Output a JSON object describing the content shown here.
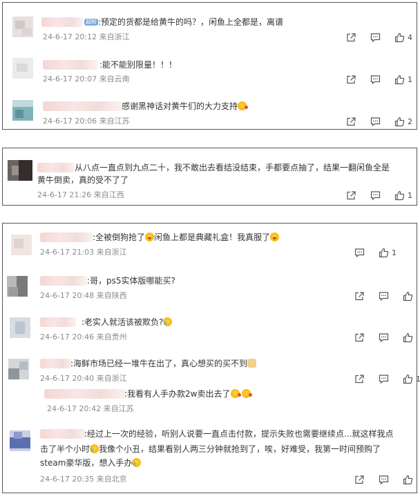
{
  "panels": [
    {
      "comments": [
        {
          "text": "预定的货都是给黄牛的吗？，闲鱼上全都是，离谱",
          "badge": "超粉",
          "date": "24-6-17 20:12",
          "location": "来自浙江",
          "likes": "4"
        },
        {
          "text": "能不能别限量！！！",
          "date": "24-6-17 20:07",
          "location": "来自云南",
          "likes": "1"
        },
        {
          "text": "感谢黑神话对黄牛们的大力支持",
          "date": "24-6-17 20:06",
          "location": "来自江苏",
          "likes": "2"
        }
      ]
    },
    {
      "comments": [
        {
          "text_line1": "从八点一直点到九点二十，我不敢出去看结没结束，手都要点抽了，结果一翻闲鱼全是",
          "text_line2": "黄牛倒卖，真的受不了了",
          "date": "24-6-17 21:26",
          "location": "来自江西",
          "likes": "1"
        }
      ]
    },
    {
      "comments": [
        {
          "text_a": "全被倒狗抢了",
          "text_b": "闲鱼上都是典藏礼盒！我真服了",
          "date": "24-6-17 21:03",
          "location": "来自浙江",
          "likes": "1"
        },
        {
          "text": "哥，ps5实体版哪能买?",
          "date": "24-6-17 20:48",
          "location": "来自陕西"
        },
        {
          "text": "老实人就活该被欺负?",
          "date": "24-6-17 20:46",
          "location": "来自贵州"
        },
        {
          "text": "海鲜市场已经一堆牛在出了，真心想买的买不到",
          "date": "24-6-17 20:40",
          "location": "来自浙江",
          "likes": "1"
        },
        {
          "text": "我看有人手办款2w卖出去了",
          "date": "24-6-17 20:42",
          "location": "来自江苏"
        },
        {
          "text_line1": "经过上一次的经验，听别人说要一直点击付款，提示失败也需要继续点...就这样我点",
          "text_line2a": "击了半个小时",
          "text_line2b": "我像个小丑，结果看别人两三分钟就抢到了，唉，好难受，我第一时间预购了",
          "text_line3": "steam豪华版，想入手办",
          "date": "24-6-17 20:35",
          "location": "来自北京"
        }
      ]
    }
  ],
  "icons": {
    "share": "share-icon",
    "comment": "comment-icon",
    "like": "thumbs-up-icon"
  }
}
